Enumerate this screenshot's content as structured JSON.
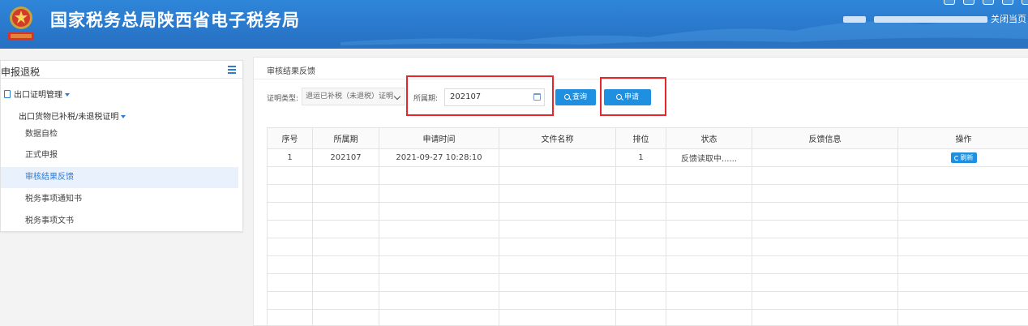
{
  "header": {
    "site_title": "国家税务总局陕西省电子税务局",
    "close_page": "关闭当页",
    "brand_color": "#2a79cc"
  },
  "sidebar": {
    "title": "申报退税",
    "group_label": "出口证明管理",
    "sub_group_label": "出口货物已补税/未退税证明",
    "items": [
      {
        "label": "数据自检",
        "active": false
      },
      {
        "label": "正式申报",
        "active": false
      },
      {
        "label": "审核结果反馈",
        "active": true
      },
      {
        "label": "税务事项通知书",
        "active": false
      },
      {
        "label": "税务事项文书",
        "active": false
      }
    ]
  },
  "main": {
    "title": "审核结果反馈",
    "cert_type_label": "证明类型:",
    "cert_type_value": "退运已补税（未退税）证明",
    "period_label": "所属期:",
    "period_value": "202107",
    "query_button": "查询",
    "apply_button": "申请"
  },
  "table": {
    "headers": [
      "序号",
      "所属期",
      "申请时间",
      "文件名称",
      "排位",
      "状态",
      "反馈信息",
      "操作"
    ],
    "rows": [
      {
        "index": "1",
        "period": "202107",
        "time": "2021-09-27 10:28:10",
        "file": "",
        "rank": "1",
        "status": "反馈读取中......",
        "feedback": "",
        "action": "刷新"
      }
    ]
  }
}
